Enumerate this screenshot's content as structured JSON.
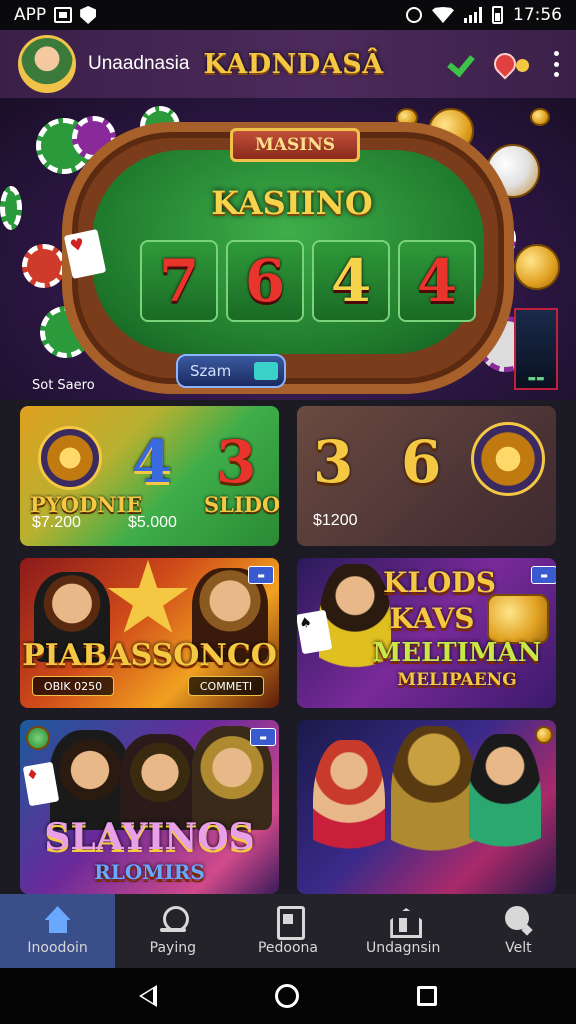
{
  "status_bar": {
    "app_label": "APP",
    "time": "17:56",
    "icons": [
      "image-icon",
      "shield-icon",
      "alarm-icon",
      "wifi-icon",
      "signal-icon",
      "battery-icon"
    ]
  },
  "header": {
    "brand_small": "Unaadnasia",
    "brand_big": "KADNDASÂ",
    "icons": [
      "avatar",
      "check-icon",
      "location-icon",
      "more-vert-icon"
    ],
    "colors": {
      "background": "#4d2a5c",
      "brand": "#f5c843",
      "check": "#3fc24a"
    }
  },
  "banner": {
    "sign": "MASINS",
    "title": "KASIINO",
    "reels": [
      "7",
      "6",
      "4",
      "4"
    ],
    "spin_button": "Szam",
    "caption": "Sot Saero"
  },
  "tiles": [
    {
      "label": "PYODNIE",
      "numbers": [
        "4",
        "3"
      ],
      "brand": "SLIDO",
      "amounts": [
        "$7.200",
        "$5.000"
      ]
    },
    {
      "numbers": [
        "3",
        "6"
      ],
      "amount": "$1200"
    },
    {
      "title": "PIABASSONCO",
      "pills": [
        "OBIK 0250",
        "COMMETI"
      ]
    },
    {
      "title_lines": [
        "KLODS",
        "KAVS",
        "MELTIMAN",
        "MELIPAENG"
      ]
    },
    {
      "title": "SLAYINOS",
      "subtitle": "RLOMIRS"
    },
    {
      "title": ""
    }
  ],
  "bottom_nav": [
    {
      "label": "Inoodoin",
      "icon": "home-icon",
      "active": true
    },
    {
      "label": "Paying",
      "icon": "bell-icon",
      "active": false
    },
    {
      "label": "Pedoona",
      "icon": "document-icon",
      "active": false
    },
    {
      "label": "Undagnsin",
      "icon": "house-person-icon",
      "active": false
    },
    {
      "label": "Velt",
      "icon": "search-icon",
      "active": false
    }
  ],
  "colors": {
    "nav_active": "#3a4e8a",
    "gold": "#f5c843",
    "red": "#e8342a"
  }
}
